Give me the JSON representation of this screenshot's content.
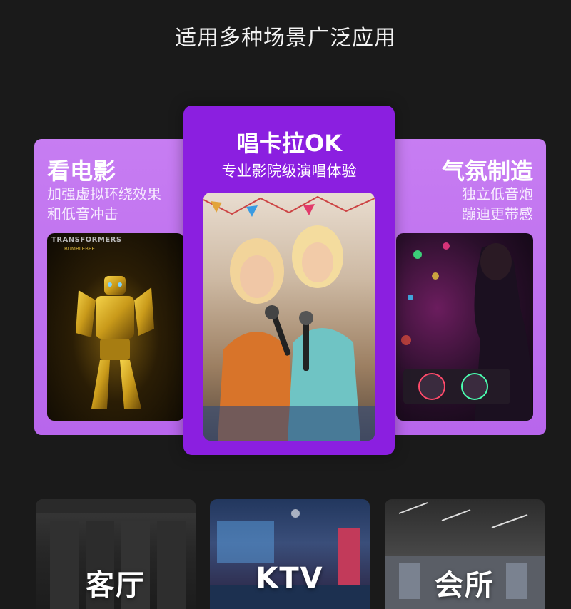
{
  "page": {
    "title": "适用多种场景广泛应用"
  },
  "cards": {
    "movie": {
      "title": "看电影",
      "desc_line1": "加强虚拟环绕效果",
      "desc_line2": "和低音冲击",
      "poster_title": "TRANSFORMERS",
      "poster_sub": "BUMBLEBEE"
    },
    "karaoke": {
      "title": "唱卡拉OK",
      "desc": "专业影院级演唱体验"
    },
    "atmosphere": {
      "title": "气氛制造",
      "desc_line1": "独立低音炮",
      "desc_line2": "蹦迪更带感"
    }
  },
  "scenes": [
    {
      "label": "客厅"
    },
    {
      "label": "KTV"
    },
    {
      "label": "会所"
    }
  ],
  "colors": {
    "background": "#1a1a1a",
    "side_card": "#c77df2",
    "center_card": "#8b1fe0"
  }
}
